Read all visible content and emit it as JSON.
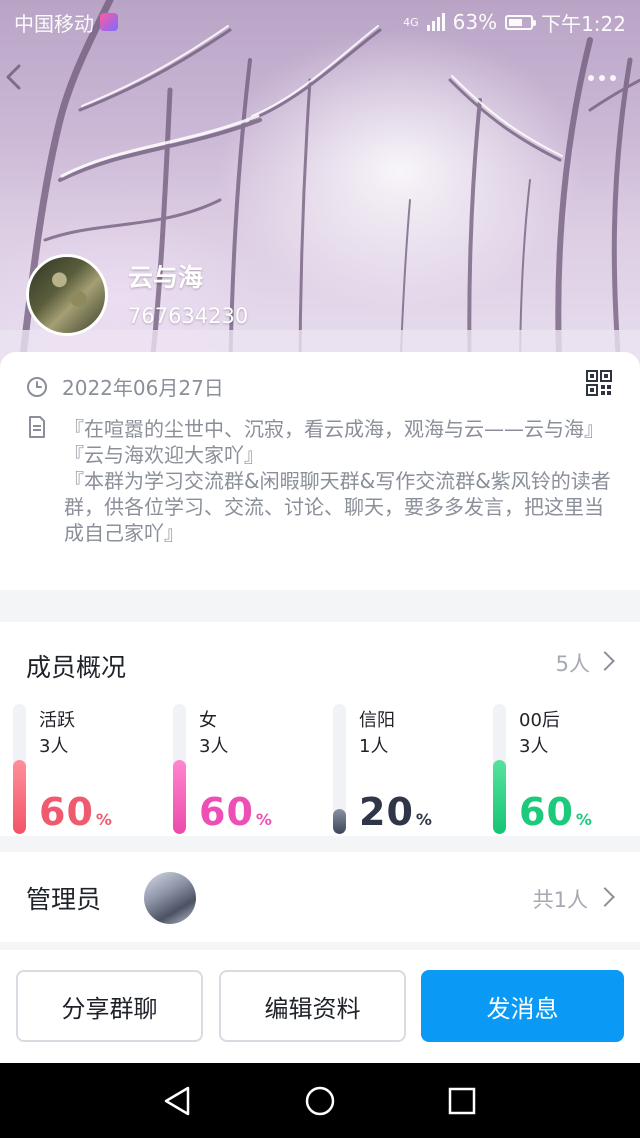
{
  "status_bar": {
    "carrier": "中国移动",
    "network": "4G",
    "battery": "63%",
    "time": "下午1:22"
  },
  "header": {
    "group_name": "云与海",
    "group_id": "767634230"
  },
  "info": {
    "date": "2022年06月27日",
    "description_lines": [
      "『在喧嚣的尘世中、沉寂，看云成海，观海与云——云与海』",
      "『云与海欢迎大家吖』",
      "『本群为学习交流群&闲暇聊天群&写作交流群&紫风铃的读者群，供各位学习、交流、讨论、聊天，要多多发言，把这里当成自己家吖』"
    ]
  },
  "members": {
    "title": "成员概况",
    "count": "5人",
    "stats": [
      {
        "label": "活跃",
        "count": "3人",
        "percent": "60",
        "unit": "%",
        "fill": 0.6,
        "color": "#f05a6e",
        "bar_from": "#ff8f9c",
        "bar_to": "#f25467"
      },
      {
        "label": "女",
        "count": "3人",
        "percent": "60",
        "unit": "%",
        "fill": 0.6,
        "color": "#ee4fb5",
        "bar_from": "#ff86cf",
        "bar_to": "#ec4aad"
      },
      {
        "label": "信阳",
        "count": "1人",
        "percent": "20",
        "unit": "%",
        "fill": 0.2,
        "color": "#2f3648",
        "bar_from": "#8a91a5",
        "bar_to": "#3d4458"
      },
      {
        "label": "00后",
        "count": "3人",
        "percent": "60",
        "unit": "%",
        "fill": 0.6,
        "color": "#1dc97a",
        "bar_from": "#55e39f",
        "bar_to": "#17c474"
      }
    ]
  },
  "admin": {
    "title": "管理员",
    "count": "共1人"
  },
  "actions": {
    "share": "分享群聊",
    "edit": "编辑资料",
    "message": "发消息"
  },
  "colors": {
    "primary": "#0a99f5",
    "muted_text": "#8a8f99"
  }
}
